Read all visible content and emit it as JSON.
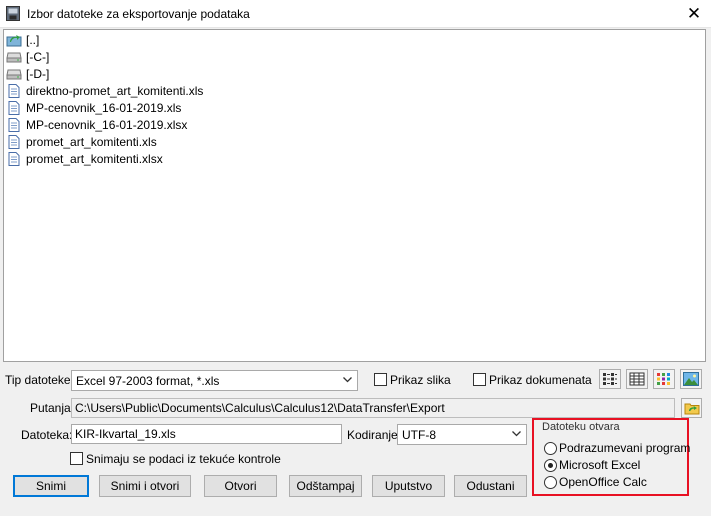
{
  "window": {
    "title": "Izbor datoteke za eksportovanje podataka",
    "close_glyph": "✕"
  },
  "files": [
    {
      "name": "[..]",
      "icon": "folder-up-icon"
    },
    {
      "name": "[-C-]",
      "icon": "drive-icon"
    },
    {
      "name": "[-D-]",
      "icon": "drive-icon"
    },
    {
      "name": "direktno-promet_art_komitenti.xls",
      "icon": "document-icon"
    },
    {
      "name": "MP-cenovnik_16-01-2019.xls",
      "icon": "document-icon"
    },
    {
      "name": "MP-cenovnik_16-01-2019.xlsx",
      "icon": "document-icon"
    },
    {
      "name": "promet_art_komitenti.xls",
      "icon": "document-icon"
    },
    {
      "name": "promet_art_komitenti.xlsx",
      "icon": "document-icon"
    }
  ],
  "file_type": {
    "label": "Tip datoteke:",
    "value": "Excel 97-2003 format, *.xls"
  },
  "options": {
    "show_images": "Prikaz slika",
    "show_documents": "Prikaz dokumenata"
  },
  "path": {
    "label": "Putanja:",
    "value": "C:\\Users\\Public\\Documents\\Calculus\\Calculus12\\DataTransfer\\Export"
  },
  "file": {
    "label": "Datoteka:",
    "value": "KIR-Ikvartal_19.xls"
  },
  "encoding": {
    "label": "Kodiranje:",
    "value": "UTF-8"
  },
  "save_from_control": "Snimaju se podaci iz tekuće kontrole",
  "open_with": {
    "legend": "Datoteku otvara",
    "options": [
      "Podrazumevani program",
      "Microsoft Excel",
      "OpenOffice Calc"
    ],
    "selected": "Microsoft Excel"
  },
  "buttons": {
    "save": "Snimi",
    "save_open": "Snimi i otvori",
    "open": "Otvori",
    "print": "Odštampaj",
    "help": "Uputstvo",
    "cancel": "Odustani"
  },
  "colors": {
    "highlight_border": "#e81123",
    "default_button_border": "#0078d7"
  }
}
